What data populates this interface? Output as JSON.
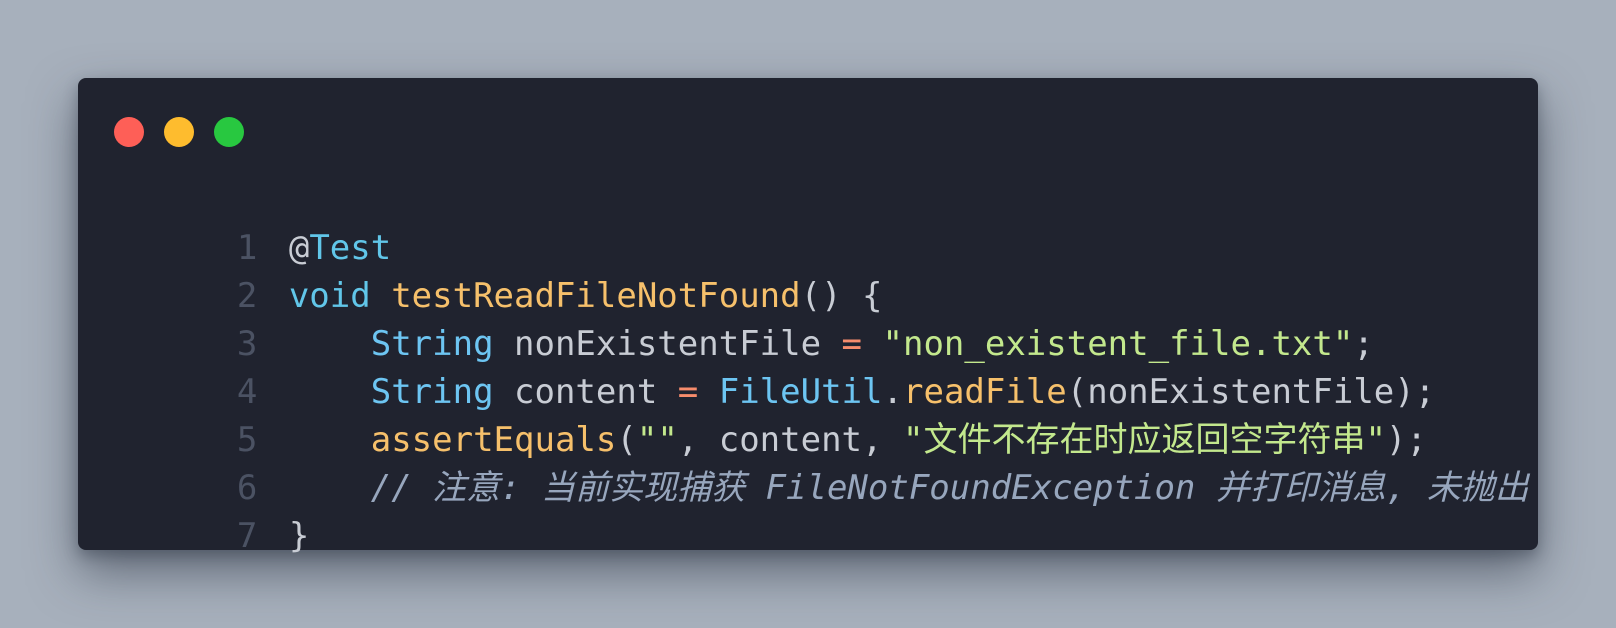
{
  "window_controls": {
    "close_color": "#fe5f57",
    "minimize_color": "#febc2e",
    "maximize_color": "#28c840"
  },
  "code": {
    "lines": [
      {
        "number": "1",
        "tokens": [
          "@",
          "Test"
        ]
      },
      {
        "number": "2",
        "tokens": [
          "void",
          " ",
          "testReadFileNotFound",
          "() {"
        ]
      },
      {
        "number": "3",
        "tokens": [
          "    ",
          "String",
          " nonExistentFile ",
          "=",
          " ",
          "\"non_existent_file.txt\"",
          ";"
        ]
      },
      {
        "number": "4",
        "tokens": [
          "    ",
          "String",
          " content ",
          "=",
          " ",
          "FileUtil",
          ".",
          "readFile",
          "(nonExistentFile);"
        ]
      },
      {
        "number": "5",
        "tokens": [
          "    ",
          "assertEquals",
          "(",
          "\"\"",
          ", content, ",
          "\"文件不存在时应返回空字符串\"",
          ");"
        ]
      },
      {
        "number": "6",
        "tokens": [
          "    ",
          "// 注意: 当前实现捕获 FileNotFoundException 并打印消息, 未抛出"
        ]
      },
      {
        "number": "7",
        "tokens": [
          "}"
        ]
      }
    ]
  }
}
